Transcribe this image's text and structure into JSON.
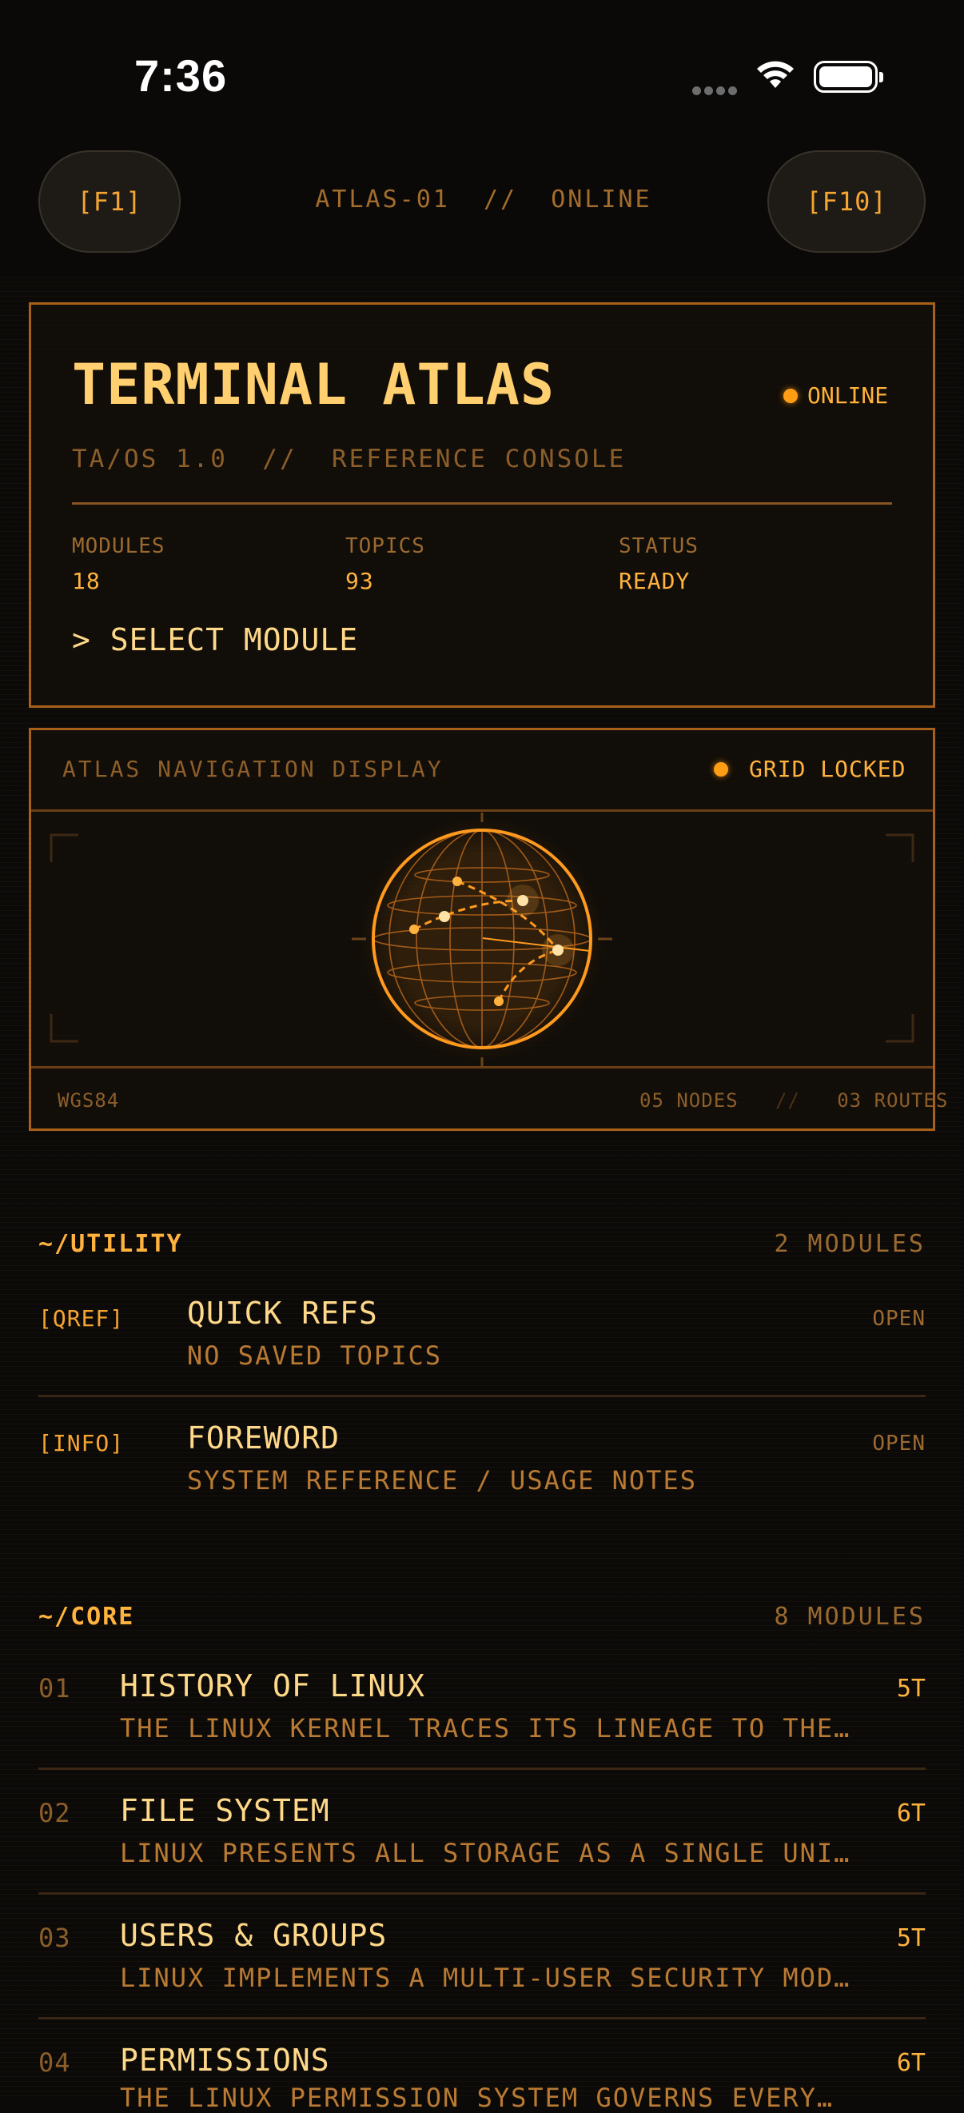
{
  "status_bar": {
    "time": "7:36"
  },
  "header": {
    "left_button": "[F1]",
    "right_button": "[F10]",
    "title": "ATLAS-01  //  ONLINE"
  },
  "hero": {
    "title": "TERMINAL ATLAS",
    "status": "ONLINE",
    "subtitle": "TA/OS 1.0  //  REFERENCE CONSOLE",
    "stats": [
      {
        "label": "MODULES",
        "value": "18"
      },
      {
        "label": "TOPICS",
        "value": "93"
      },
      {
        "label": "STATUS",
        "value": "READY"
      }
    ],
    "command": "> SELECT MODULE"
  },
  "nav_display": {
    "title": "ATLAS NAVIGATION DISPLAY",
    "lock_status": "GRID LOCKED",
    "datum": "WGS84",
    "nodes": "05 NODES",
    "separator": "//",
    "routes": "03 ROUTES"
  },
  "utility": {
    "header": "~/UTILITY",
    "count": "2 MODULES",
    "items": [
      {
        "tag": "[QREF]",
        "title": "QUICK REFS",
        "subtitle": "NO SAVED TOPICS",
        "action": "OPEN"
      },
      {
        "tag": "[INFO]",
        "title": "FOREWORD",
        "subtitle": "SYSTEM REFERENCE / USAGE NOTES",
        "action": "OPEN"
      }
    ]
  },
  "core": {
    "header": "~/CORE",
    "count": "8 MODULES",
    "items": [
      {
        "num": "01",
        "title": "HISTORY OF LINUX",
        "subtitle": "THE LINUX KERNEL TRACES ITS LINEAGE TO THE…",
        "topics": "5T"
      },
      {
        "num": "02",
        "title": "FILE SYSTEM",
        "subtitle": "LINUX PRESENTS ALL STORAGE AS A SINGLE UNI…",
        "topics": "6T"
      },
      {
        "num": "03",
        "title": "USERS & GROUPS",
        "subtitle": "LINUX IMPLEMENTS A MULTI-USER SECURITY MOD…",
        "topics": "5T"
      },
      {
        "num": "04",
        "title": "PERMISSIONS",
        "subtitle": "THE LINUX PERMISSION SYSTEM GOVERNS EVERY…",
        "topics": "6T"
      }
    ]
  }
}
